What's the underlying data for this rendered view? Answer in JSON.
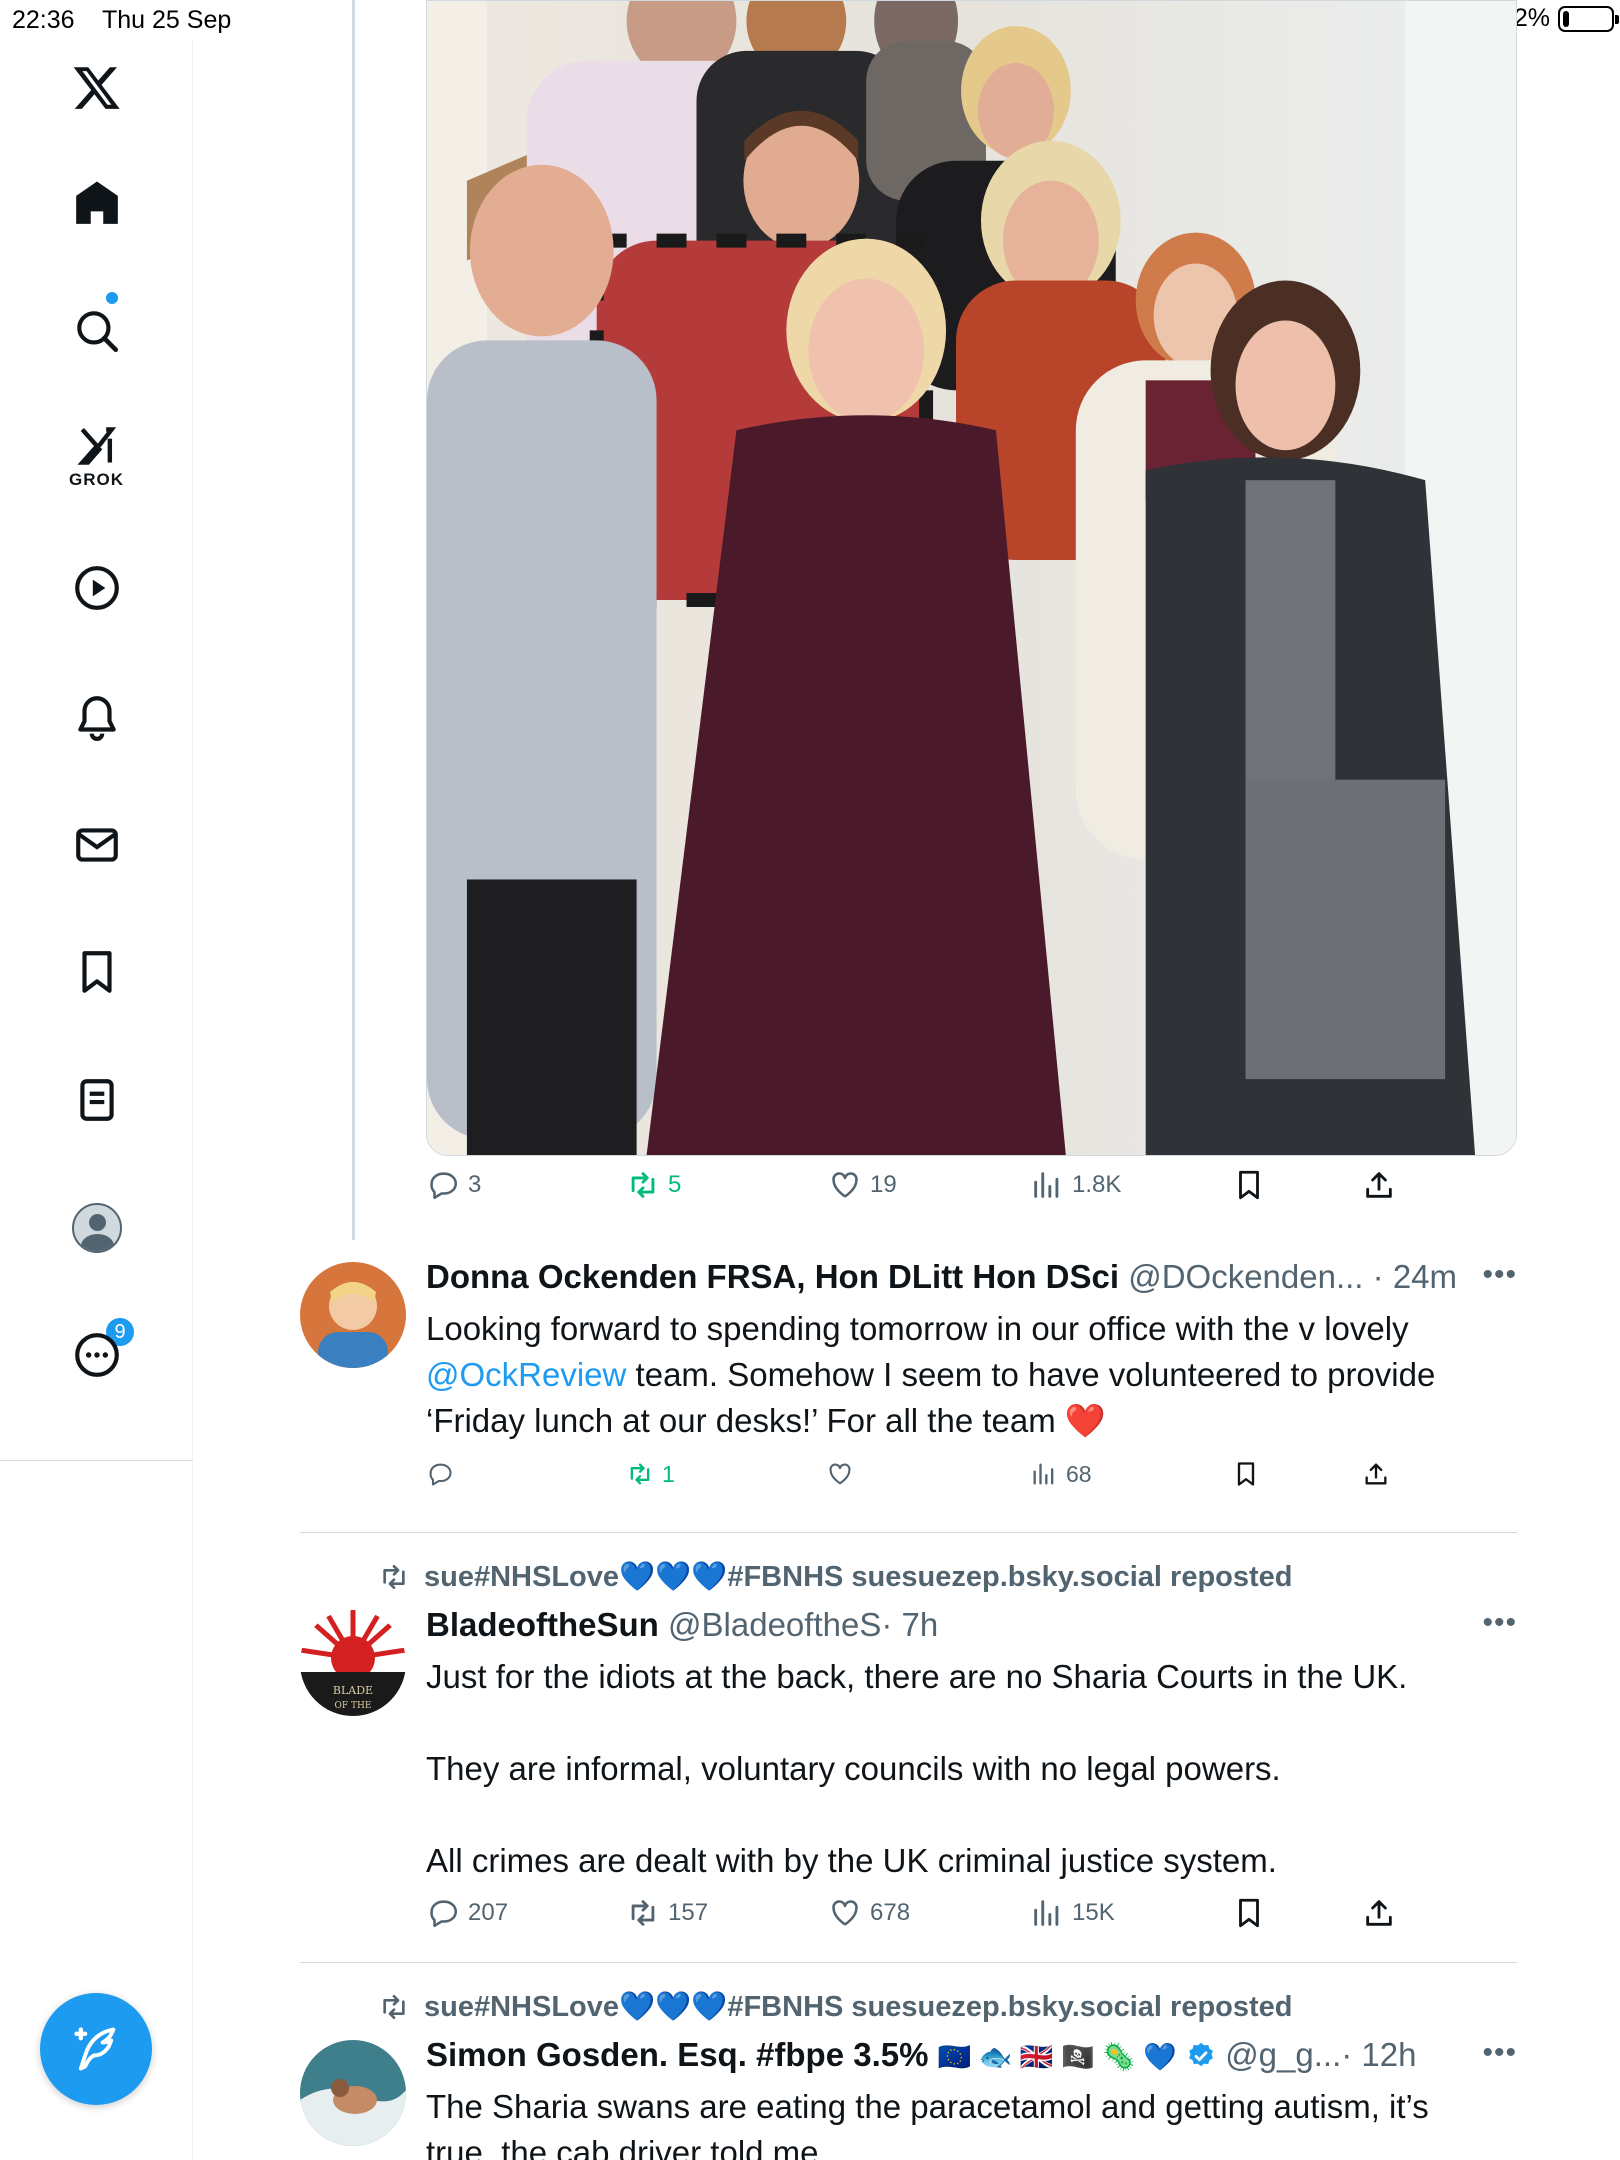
{
  "status": {
    "time": "22:36",
    "date": "Thu 25 Sep",
    "battery": "12%"
  },
  "sidebar": {
    "items": [
      {
        "name": "x-logo-icon"
      },
      {
        "name": "home-icon"
      },
      {
        "name": "search-icon"
      },
      {
        "name": "grok-icon",
        "label": "GROK"
      },
      {
        "name": "video-icon"
      },
      {
        "name": "notifications-icon",
        "badge": "9"
      },
      {
        "name": "messages-icon"
      },
      {
        "name": "bookmarks-icon"
      },
      {
        "name": "lists-icon"
      },
      {
        "name": "profile-icon"
      },
      {
        "name": "more-icon"
      }
    ],
    "compose_icon": "compose-icon"
  },
  "photo_tweet": {
    "reply_count": "3",
    "repost_count": "5",
    "like_count": "19",
    "view_count": "1.8K"
  },
  "tweets": [
    {
      "name": "Donna Ockenden FRSA, Hon DLitt Hon DSci",
      "handle": "@DOckenden...",
      "time": "· 24m",
      "text_line1": "Looking forward to spending tomorrow  in our office with the v lovely",
      "mention": "@OckReview",
      "text_line2_rest": " team. Somehow I seem to have volunteered to provide",
      "text_line3": "‘Friday lunch at our desks!’ For all the team ❤️",
      "replies": "",
      "reposts": "1",
      "likes": "",
      "views": "68"
    },
    {
      "repost_by_prefix": "sue#NHSLove",
      "repost_by_hearts": "💙💙💙",
      "repost_by_suffix": "#FBNHS suesuezep.bsky.social reposted",
      "name": "BladeoftheSun",
      "handle": "@BladeoftheS",
      "time": "· 7h",
      "p1": "Just for the idiots at the back, there are no Sharia Courts in the UK.",
      "p2": "They are informal, voluntary councils with no legal powers.",
      "p3": "All crimes are dealt with by the UK criminal justice system.",
      "replies": "207",
      "reposts": "157",
      "likes": "678",
      "views": "15K"
    },
    {
      "repost_by_prefix": "sue#NHSLove",
      "repost_by_hearts": "💙💙💙",
      "repost_by_suffix": "#FBNHS suesuezep.bsky.social reposted",
      "name": "Simon Gosden. Esq. #fbpe 3.5%",
      "name_emoji": "🇪🇺 🐟 🇬🇧 🏴‍☠️ 🦠 💙",
      "handle": "@g_g...",
      "time": "· 12h",
      "text_line1": "The Sharia swans are eating the paracetamol and getting autism, it’s",
      "text_line2": "true, the cab driver told me"
    }
  ],
  "colors": {
    "accent": "#1d9bf0",
    "repost": "#00ba7c",
    "muted": "#536471",
    "text": "#0f1419"
  }
}
